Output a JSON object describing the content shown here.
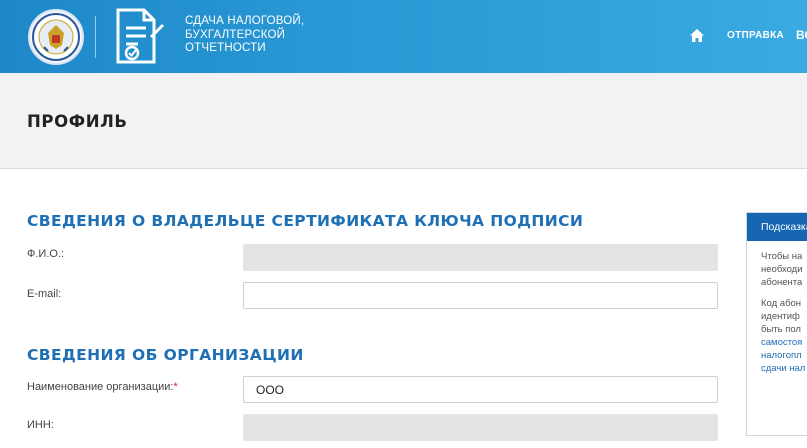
{
  "header": {
    "service_title_lines": [
      "СДАЧА НАЛОГОВОЙ,",
      "БУХГАЛТЕРСКОЙ",
      "ОТЧЕТНОСТИ"
    ],
    "nav_link": "ОТПРАВКА",
    "nav_cut": "ВО",
    "brand_color": "#2a9ad6"
  },
  "page": {
    "title": "ПРОФИЛЬ"
  },
  "owner_section": {
    "title": "СВЕДЕНИЯ О ВЛАДЕЛЬЦЕ СЕРТИФИКАТА КЛЮЧА ПОДПИСИ",
    "fio_label": "Ф.И.О.:",
    "fio_value": "",
    "email_label": "E-mail:",
    "email_value": ""
  },
  "org_section": {
    "title": "СВЕДЕНИЯ ОБ ОРГАНИЗАЦИИ",
    "name_label": "Наименование организации:",
    "required_mark": "*",
    "name_value": "ООО",
    "inn_label": "ИНН:",
    "inn_value": ""
  },
  "hint": {
    "title": "Подсказка",
    "paragraph1_lines": [
      "Чтобы на",
      "необходи",
      "абонента"
    ],
    "paragraph2_lines": [
      "Код абон",
      "идентиф",
      "быть пол"
    ],
    "paragraph2_link_lines": [
      "самостоя",
      "налогопл",
      "сдачи нал"
    ],
    "accent_color": "#1565b3"
  }
}
